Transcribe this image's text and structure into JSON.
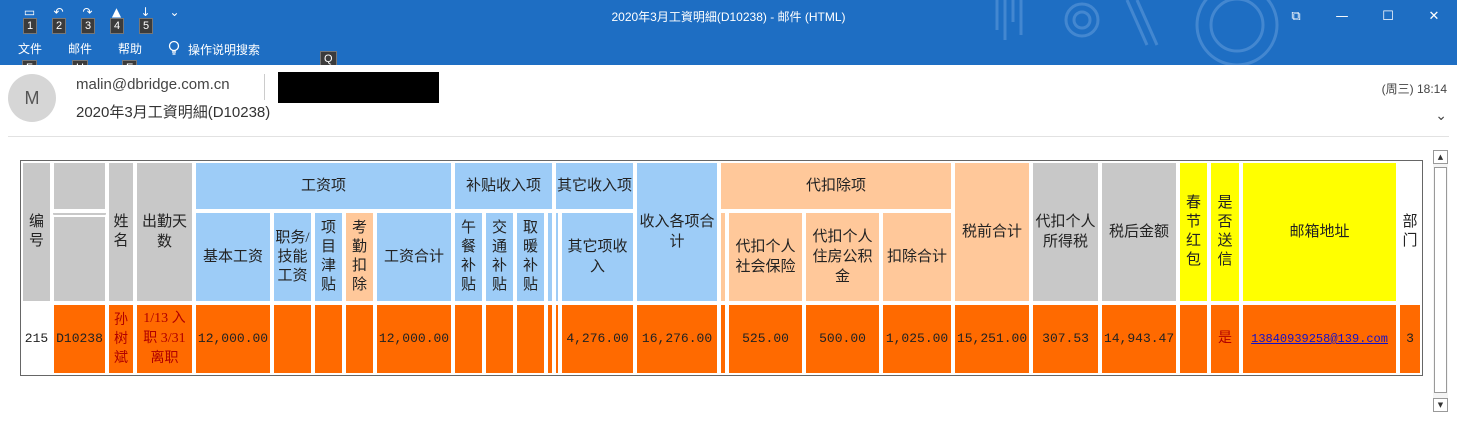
{
  "window": {
    "title": "2020年3月工資明細(D10238)  -  邮件 (HTML)",
    "controls": [
      "restore-box",
      "minimize",
      "maximize",
      "close"
    ]
  },
  "quick_access": {
    "keytips": [
      "1",
      "2",
      "3",
      "4",
      "5"
    ]
  },
  "menu": {
    "items": [
      {
        "label": "文件",
        "keytip": "F"
      },
      {
        "label": "邮件",
        "keytip": "H"
      },
      {
        "label": "帮助",
        "keytip": "E"
      }
    ],
    "search_label": "操作说明搜索",
    "search_keytip": "Q"
  },
  "message": {
    "avatar_initial": "M",
    "sender": "malin@dbridge.com.cn",
    "subject": "2020年3月工資明細(D10238)",
    "datetime": "(周三) 18:14"
  },
  "table": {
    "headers": {
      "id": "编号",
      "name": "姓名",
      "attendance": "出勤天数",
      "salary_group": "工资项",
      "basic": "基本工资",
      "position": "职务/技能工资",
      "project": "项目津贴",
      "attendance_deduct": "考勤扣除",
      "salary_total": "工资合计",
      "allowance_group": "补贴收入项",
      "meal": "午餐补贴",
      "transport": "交通补贴",
      "heating": "取暖补贴",
      "other_group": "其它收入项",
      "other_income": "其它项收入",
      "income_total": "收入各项合计",
      "deduct_group": "代扣除项",
      "social_insurance": "代扣个人社会保险",
      "housing_fund": "代扣个人住房公积金",
      "deduct_total": "扣除合计",
      "pretax_total": "税前合计",
      "income_tax": "代扣个人 所得税",
      "aftertax": "税后金额",
      "bonus": "春节红包",
      "send_flag": "是否送信",
      "email": "邮箱地址",
      "dept": "部门"
    },
    "row": {
      "id": "215",
      "emp_code": "D10238",
      "name": "孙树斌",
      "attendance": "1/13 入职 3/31 离职",
      "basic": "12,000.00",
      "position": "",
      "project": "",
      "attendance_deduct": "",
      "salary_total": "12,000.00",
      "meal": "",
      "transport": "",
      "heating": "",
      "other_income": "4,276.00",
      "income_total": "16,276.00",
      "social_insurance": "525.00",
      "housing_fund": "500.00",
      "deduct_total": "1,025.00",
      "pretax_total": "15,251.00",
      "income_tax": "307.53",
      "aftertax": "14,943.47",
      "bonus": "",
      "send_flag": "是",
      "email": "13840939258@139.com",
      "dept": "3"
    }
  }
}
